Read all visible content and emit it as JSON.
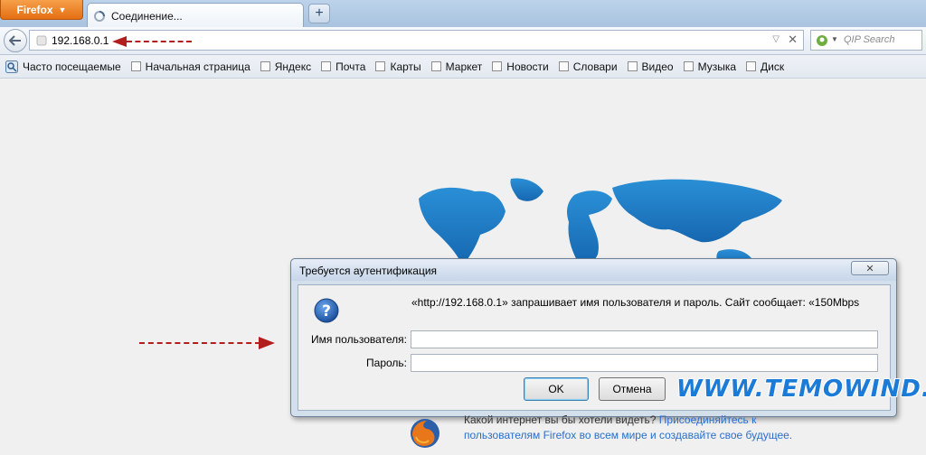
{
  "browser": {
    "menu_button": "Firefox",
    "tab_title": "Соединение...",
    "new_tab": "+",
    "url": "192.168.0.1",
    "search_placeholder": "QIP Search"
  },
  "bookmarks": [
    "Часто посещаемые",
    "Начальная страница",
    "Яндекс",
    "Почта",
    "Карты",
    "Маркет",
    "Новости",
    "Словари",
    "Видео",
    "Музыка",
    "Диск"
  ],
  "dialog": {
    "title": "Требуется аутентификация",
    "message": "«http://192.168.0.1» запрашивает имя пользователя и пароль. Сайт сообщает: «150Mbps",
    "username_label": "Имя пользователя:",
    "password_label": "Пароль:",
    "username_value": "",
    "password_value": "",
    "ok_label": "OK",
    "cancel_label": "Отмена"
  },
  "promo": {
    "line1_text": "Какой интернет вы бы хотели видеть? ",
    "line1_link": "Присоединяйтесь к",
    "line2_link": "пользователям Firefox во всем мире и создавайте свое будущее."
  },
  "watermark": "WWW.TEMOWIND.RU",
  "colors": {
    "accent": "#e46e12",
    "annotation_arrow": "#b21e1e",
    "watermark": "#1b7bd6",
    "link": "#2a6fc9"
  }
}
